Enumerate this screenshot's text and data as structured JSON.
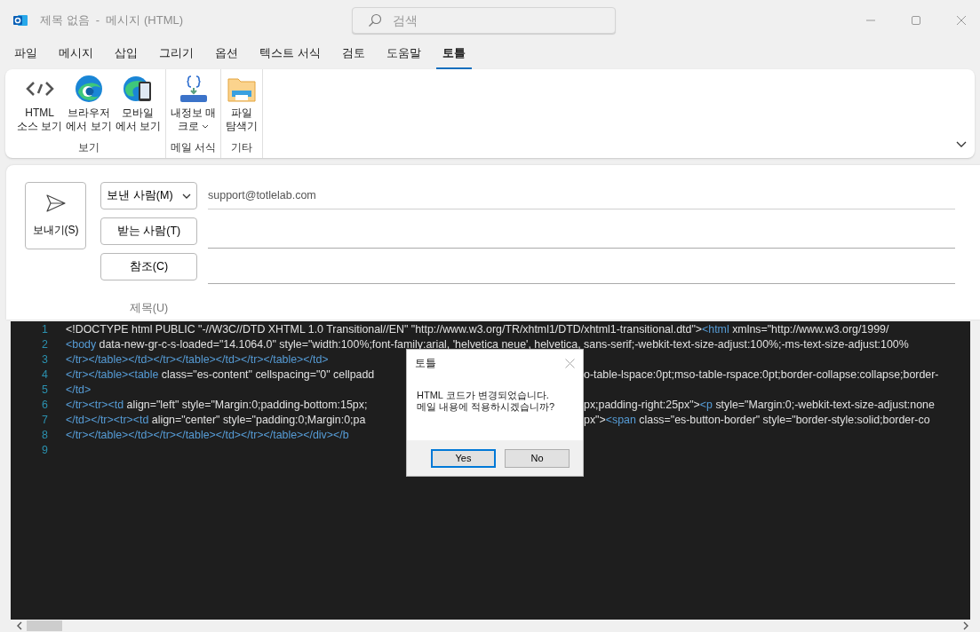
{
  "window": {
    "title": "제목 없음  -  메시지 (HTML)",
    "search": {
      "placeholder": "검색"
    }
  },
  "tabs": [
    {
      "label": "파일",
      "selected": false
    },
    {
      "label": "메시지",
      "selected": false
    },
    {
      "label": "삽입",
      "selected": false
    },
    {
      "label": "그리기",
      "selected": false
    },
    {
      "label": "옵션",
      "selected": false
    },
    {
      "label": "텍스트 서식",
      "selected": false
    },
    {
      "label": "검토",
      "selected": false
    },
    {
      "label": "도움말",
      "selected": false
    },
    {
      "label": "토틀",
      "selected": true
    }
  ],
  "ribbon": {
    "groups": [
      {
        "label": "보기",
        "buttons": [
          {
            "kind": "code",
            "label": "HTML\n소스 보기",
            "dropdown": false
          },
          {
            "kind": "browser",
            "label": "브라우저\n에서 보기",
            "dropdown": false
          },
          {
            "kind": "mobile",
            "label": "모바일\n에서 보기",
            "dropdown": false
          }
        ]
      },
      {
        "label": "메일 서식",
        "buttons": [
          {
            "kind": "macro",
            "label": "내정보 매\n크로",
            "dropdown": true
          }
        ]
      },
      {
        "label": "기타",
        "buttons": [
          {
            "kind": "folder",
            "label": "파일\n탐색기",
            "dropdown": false
          }
        ]
      }
    ]
  },
  "compose": {
    "send": {
      "label": "보내기(S)"
    },
    "fields": [
      {
        "kind": "dropdown",
        "label": "보낸 사람(M)",
        "value": "support@totlelab.com"
      },
      {
        "kind": "button",
        "label": "받는 사람(T)"
      },
      {
        "kind": "button",
        "label": "참조(C)"
      },
      {
        "kind": "label",
        "label": "제목(U)"
      }
    ]
  },
  "editor": {
    "lines": [
      {
        "number": "1",
        "left": [
          {
            "kind": "text",
            "text": "<!DOCTYPE html PUBLIC \"-//W3C//DTD XHTML 1.0 Transitional//EN\" \"http://www.w3.org/TR/xhtml1/DTD/xhtml1-transitional.dtd\">"
          },
          {
            "kind": "tag",
            "text": "<html"
          },
          {
            "kind": "text",
            "text": " xmlns=\"http://www.w3.org/1999/"
          }
        ]
      },
      {
        "number": "2",
        "left": [
          {
            "kind": "tag",
            "text": "<body"
          },
          {
            "kind": "text",
            "text": " data-new-gr-c-s-loaded=\"14.1064.0\" style=\"width:100%;font-family:arial, 'helvetica neue', helvetica, sans-serif;-webkit-text-size-adjust:100%;-ms-text-size-adjust:100%"
          }
        ]
      },
      {
        "number": "3",
        "left": [
          {
            "kind": "tag",
            "text": "</tr></table></td></tr></table></td></tr></table></td>"
          }
        ]
      },
      {
        "number": "4",
        "left": [
          {
            "kind": "tag",
            "text": "</tr></table><table"
          },
          {
            "kind": "text",
            "text": " class=\"es-content\" cellspacing=\"0\" cellpadd"
          }
        ],
        "right": [
          {
            "kind": "text",
            "text": "o-table-lspace:0pt;mso-table-rspace:0pt;border-collapse:collapse;border-"
          }
        ]
      },
      {
        "number": "5",
        "left": [
          {
            "kind": "tag",
            "text": "</td>"
          }
        ]
      },
      {
        "number": "6",
        "left": [
          {
            "kind": "tag",
            "text": "</tr><tr><td"
          },
          {
            "kind": "text",
            "text": " align=\"left\" style=\"Margin:0;padding-bottom:15px;"
          }
        ],
        "right": [
          {
            "kind": "text",
            "text": "px;padding-right:25px\">"
          },
          {
            "kind": "tag",
            "text": "<p"
          },
          {
            "kind": "text",
            "text": " style=\"Margin:0;-webkit-text-size-adjust:none"
          }
        ]
      },
      {
        "number": "7",
        "left": [
          {
            "kind": "tag",
            "text": "</td></tr><tr><td"
          },
          {
            "kind": "text",
            "text": " align=\"center\" style=\"padding:0;Margin:0;pa"
          }
        ],
        "right": [
          {
            "kind": "text",
            "text": "px\">"
          },
          {
            "kind": "tag",
            "text": "<span"
          },
          {
            "kind": "text",
            "text": " class=\"es-button-border\" style=\"border-style:solid;border-co"
          }
        ]
      },
      {
        "number": "8",
        "left": [
          {
            "kind": "tag",
            "text": "</tr></table></td></tr></table></td></tr></table></div></b"
          }
        ]
      },
      {
        "number": "9"
      }
    ]
  },
  "dialog": {
    "title": "토틀",
    "message": "HTML 코드가 변경되었습니다.\n메일 내용에 적용하시겠습니까?",
    "buttons": [
      {
        "label": "Yes",
        "selected": true
      },
      {
        "label": "No",
        "selected": false
      }
    ]
  }
}
